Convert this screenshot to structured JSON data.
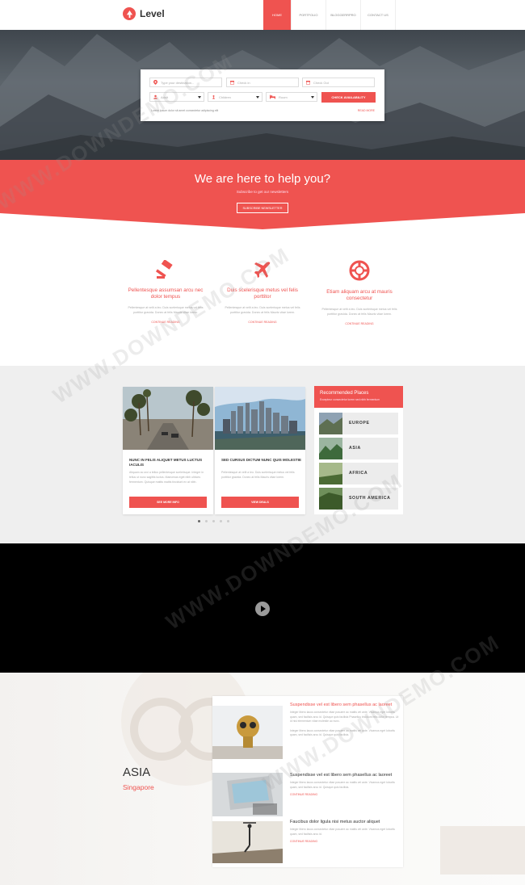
{
  "header": {
    "brand": "Level",
    "nav": [
      "HOME",
      "PORTFOLIO",
      "BLOGGERRPRO",
      "CONTACT US"
    ]
  },
  "booking": {
    "destination_placeholder": "Type your destination...",
    "checkin_placeholder": "Check in",
    "checkout_placeholder": "Check Out",
    "adults": "Adult",
    "children": "Children",
    "rooms": "Room",
    "check_button": "CHECK AVAILABILITY",
    "note": "Lorem ipsum dolor sit amet consectetur adipiscing elit",
    "read_more": "READ MORE"
  },
  "help": {
    "title": "We are here to help you?",
    "subtitle": "Subscribe to get our newsletters",
    "button": "SUBSCRIBE NEWSLETTER"
  },
  "features": [
    {
      "icon": "gavel-icon",
      "title": "Pellentesque assumsan arcu nec dolor tempus",
      "text": "Pellentesque at velit a leo. Duis scelerisque metus vel felis porttitor gravida. Donec at felis Mauris vitae lorem.",
      "link": "CONTINUE READING"
    },
    {
      "icon": "airplane-icon",
      "title": "Duis scelerisque metus vel felis porttitor",
      "text": "Pellentesque at velit a leo. Duis scelerisque metus vel felis porttitor gravida. Donec at felis Mauris vitae lorem.",
      "link": "CONTINUE READING"
    },
    {
      "icon": "lifebuoy-icon",
      "title": "Etiam aliquam arcu at mauris consectetur",
      "text": "Pellentesque at velit a leo. Duis scelerisque metus vel felis porttitor gravida. Donec at felis Mauris vitae lorem.",
      "link": "CONTINUE READING"
    }
  ],
  "cards": [
    {
      "title": "NUNC IN FELIS ALIQUET METUS LUCTUS IACULIS",
      "text": "Aliquam ac orci a tellus pellentesque scelerisque. Integer in tellus ut nunc sagittis luctus. Maecenas eget nibh ultrices fermentum. Quisque mattis mattis tincidunt ex at nibh.",
      "button": "SEE MORE INFO"
    },
    {
      "title": "SED CURSUS DICTUM NUNC QUIS MOLESTIE",
      "text": "Pellentesque at velit a leo. Duis scelerisque metus vel felis porttitor gravida. Donec at felis Mauris vitae lorem.",
      "button": "VIEW DEALS"
    }
  ],
  "recommended": {
    "title": "Recommended Places",
    "subtitle": "Excepteur consectetur lorem sed nibh fermentum",
    "places": [
      "EUROPE",
      "ASIA",
      "AFRICA",
      "SOUTH AMERICA"
    ]
  },
  "asia": {
    "title": "ASIA",
    "subtitle": "Singapore",
    "posts": [
      {
        "title": "Suspendisse vel est libero sem phasellus ac laoreet",
        "text": "Integer libero lacus consectetur vitae posuere ac mattis vel ante. Vivamus eget lobortis quam, sed facilisis arcu id. Quisque quis facilisis Phasellus tincidunt felis dolor tempus. Ut id nisi elementum vitae molestie ac nunc.",
        "text2": "Integer libero lacus consectetur vitae posuere ac mattis vel ante. Vivamus eget lobortis quam, sed facilisis arcu id. Quisque quis facilisis.",
        "link": ""
      },
      {
        "title": "Suspendisse vel est libero sem phasellus ac laoreet",
        "text": "Integer libero lacus consectetur vitae posuere ac mattis vel ante. Vivamus eget lobortis quam, sed facilisis arcu id. Quisque quis facilisis.",
        "link": "CONTINUE READING"
      },
      {
        "title": "Faucibus dolor ligula nisi metus auctor aliquet",
        "text": "Integer libero lacus consectetur vitae posuere ac mattis vel ante. Vivamus eget lobortis quam, sed facilisis arcu id.",
        "link": "CONTINUE READING"
      }
    ]
  },
  "watermark": "WWW.DOWNDEMO.COM",
  "colors": {
    "accent": "#ef5350",
    "dark": "#333333"
  }
}
